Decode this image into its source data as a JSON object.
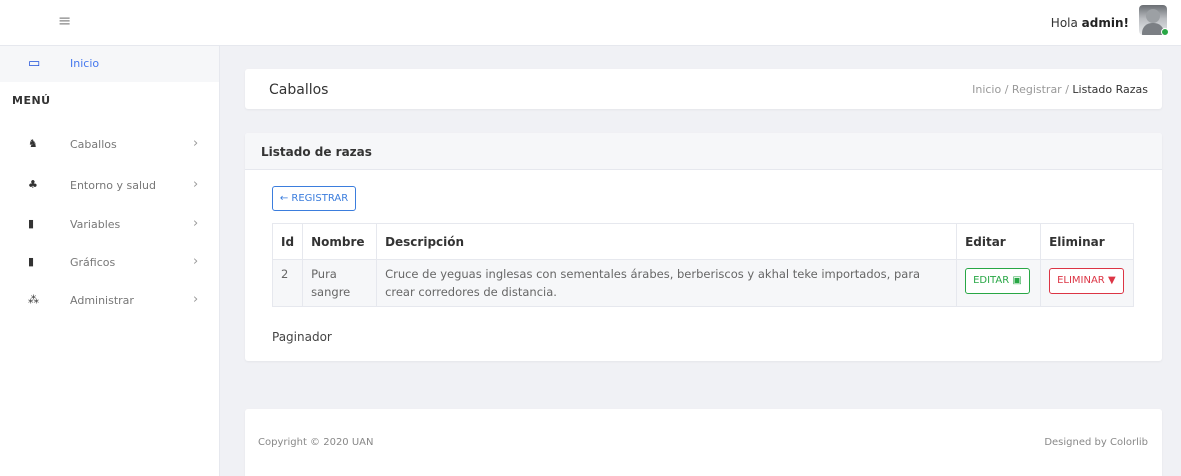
{
  "topbar": {
    "menu_icon": "hamburger-icon",
    "greeting_prefix": "Hola ",
    "greeting_user": "admin!"
  },
  "sidebar": {
    "home_label": "Inicio",
    "menu_title": "MENÚ",
    "items": [
      {
        "label": "Caballos",
        "icon": "horse-icon"
      },
      {
        "label": "Entorno y salud",
        "icon": "user-group-icon"
      },
      {
        "label": "Variables",
        "icon": "file-icon"
      },
      {
        "label": "Gráficos",
        "icon": "file-icon"
      },
      {
        "label": "Administrar",
        "icon": "users-icon"
      }
    ]
  },
  "header": {
    "title": "Caballos",
    "breadcrumb": [
      "Inicio",
      "Registrar",
      "Listado Razas"
    ]
  },
  "list": {
    "card_title": "Listado de razas",
    "register_label": "← REGISTRAR",
    "columns": [
      "Id",
      "Nombre",
      "Descripción",
      "Editar",
      "Eliminar"
    ],
    "rows": [
      {
        "id": "2",
        "nombre": "Pura sangre",
        "descripcion": "Cruce de yeguas inglesas con sementales árabes, berberiscos y akhal teke importados, para crear corredores de distancia.",
        "edit_label": "EDITAR",
        "delete_label": "ELIMINAR"
      }
    ],
    "paginator": "Paginador"
  },
  "footer": {
    "copyright": "Copyright © 2020 UAN",
    "designed": "Designed by Colorlib"
  },
  "colors": {
    "accent": "#3b7ddd",
    "success": "#28a745",
    "danger": "#dc3545"
  }
}
